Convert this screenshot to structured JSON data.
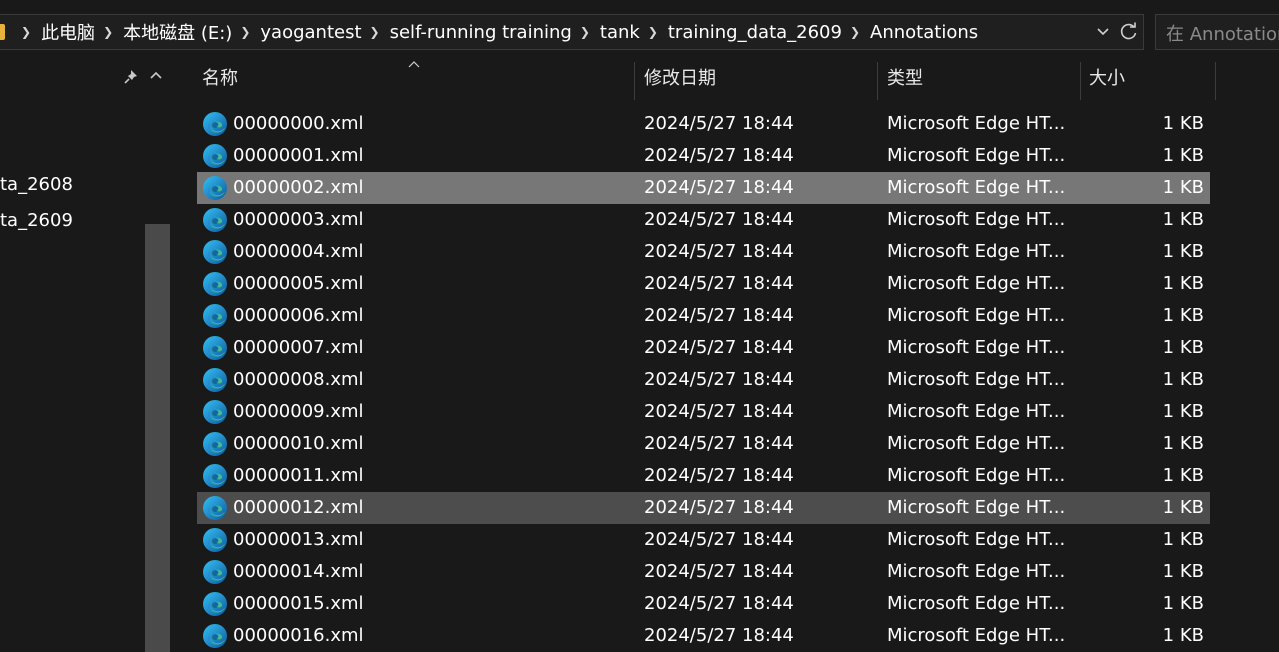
{
  "address": {
    "crumbs": [
      "此电脑",
      "本地磁盘 (E:)",
      "yaogantest",
      "self-running training",
      "tank",
      "training_data_2609",
      "Annotations"
    ],
    "search_placeholder": "在 Annotations 中搜索"
  },
  "nav": {
    "items": [
      "ta_2608",
      "ta_2609"
    ]
  },
  "columns": {
    "name": "名称",
    "date": "修改日期",
    "type": "类型",
    "size": "大小"
  },
  "colors": {
    "background": "#191919",
    "selected_row": "#777777",
    "hover_row": "#4d4d4d",
    "folder": "#e8b33a"
  },
  "files": [
    {
      "name": "00000000.xml",
      "date": "2024/5/27 18:44",
      "type": "Microsoft Edge HT...",
      "size": "1 KB"
    },
    {
      "name": "00000001.xml",
      "date": "2024/5/27 18:44",
      "type": "Microsoft Edge HT...",
      "size": "1 KB"
    },
    {
      "name": "00000002.xml",
      "date": "2024/5/27 18:44",
      "type": "Microsoft Edge HT...",
      "size": "1 KB",
      "state": "selected"
    },
    {
      "name": "00000003.xml",
      "date": "2024/5/27 18:44",
      "type": "Microsoft Edge HT...",
      "size": "1 KB"
    },
    {
      "name": "00000004.xml",
      "date": "2024/5/27 18:44",
      "type": "Microsoft Edge HT...",
      "size": "1 KB"
    },
    {
      "name": "00000005.xml",
      "date": "2024/5/27 18:44",
      "type": "Microsoft Edge HT...",
      "size": "1 KB"
    },
    {
      "name": "00000006.xml",
      "date": "2024/5/27 18:44",
      "type": "Microsoft Edge HT...",
      "size": "1 KB"
    },
    {
      "name": "00000007.xml",
      "date": "2024/5/27 18:44",
      "type": "Microsoft Edge HT...",
      "size": "1 KB"
    },
    {
      "name": "00000008.xml",
      "date": "2024/5/27 18:44",
      "type": "Microsoft Edge HT...",
      "size": "1 KB"
    },
    {
      "name": "00000009.xml",
      "date": "2024/5/27 18:44",
      "type": "Microsoft Edge HT...",
      "size": "1 KB"
    },
    {
      "name": "00000010.xml",
      "date": "2024/5/27 18:44",
      "type": "Microsoft Edge HT...",
      "size": "1 KB"
    },
    {
      "name": "00000011.xml",
      "date": "2024/5/27 18:44",
      "type": "Microsoft Edge HT...",
      "size": "1 KB"
    },
    {
      "name": "00000012.xml",
      "date": "2024/5/27 18:44",
      "type": "Microsoft Edge HT...",
      "size": "1 KB",
      "state": "hover"
    },
    {
      "name": "00000013.xml",
      "date": "2024/5/27 18:44",
      "type": "Microsoft Edge HT...",
      "size": "1 KB"
    },
    {
      "name": "00000014.xml",
      "date": "2024/5/27 18:44",
      "type": "Microsoft Edge HT...",
      "size": "1 KB"
    },
    {
      "name": "00000015.xml",
      "date": "2024/5/27 18:44",
      "type": "Microsoft Edge HT...",
      "size": "1 KB"
    },
    {
      "name": "00000016.xml",
      "date": "2024/5/27 18:44",
      "type": "Microsoft Edge HT...",
      "size": "1 KB"
    }
  ]
}
